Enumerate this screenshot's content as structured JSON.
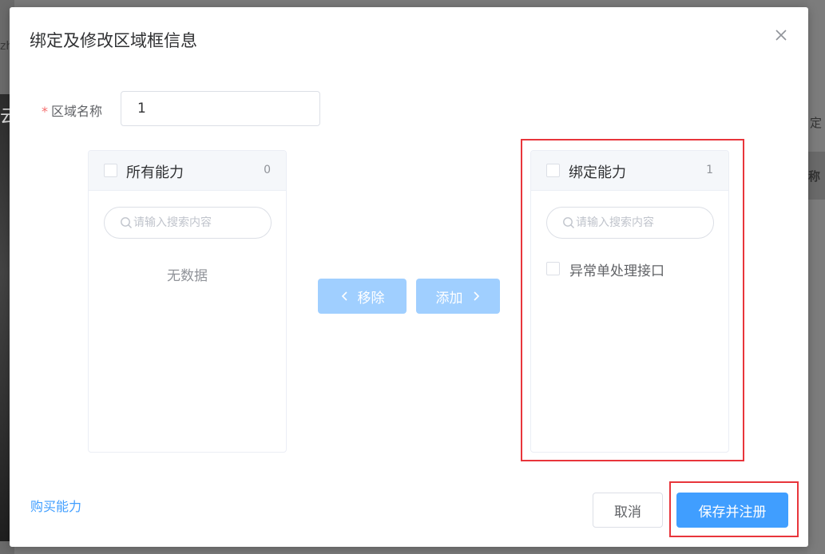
{
  "background": {
    "left_text": "zh",
    "left_text2": "云",
    "right_text1": "定",
    "right_text2": "称"
  },
  "dialog": {
    "title": "绑定及修改区域框信息",
    "close_icon": "close-icon"
  },
  "form": {
    "required_mark": "*",
    "name_label": "区域名称",
    "name_value": "1"
  },
  "transfer": {
    "left": {
      "title": "所有能力",
      "count": "0",
      "search_placeholder": "请输入搜索内容",
      "empty_text": "无数据",
      "items": []
    },
    "right": {
      "title": "绑定能力",
      "count": "1",
      "search_placeholder": "请输入搜索内容",
      "items": [
        {
          "label": "异常单处理接口",
          "checked": false
        }
      ]
    },
    "remove_label": "移除",
    "add_label": "添加"
  },
  "footer": {
    "buy_link": "购买能力",
    "cancel_label": "取消",
    "save_label": "保存并注册"
  },
  "colors": {
    "primary": "#409eff",
    "primary_disabled": "#a0cfff",
    "highlight": "#e8353b",
    "required": "#f56c6c"
  }
}
